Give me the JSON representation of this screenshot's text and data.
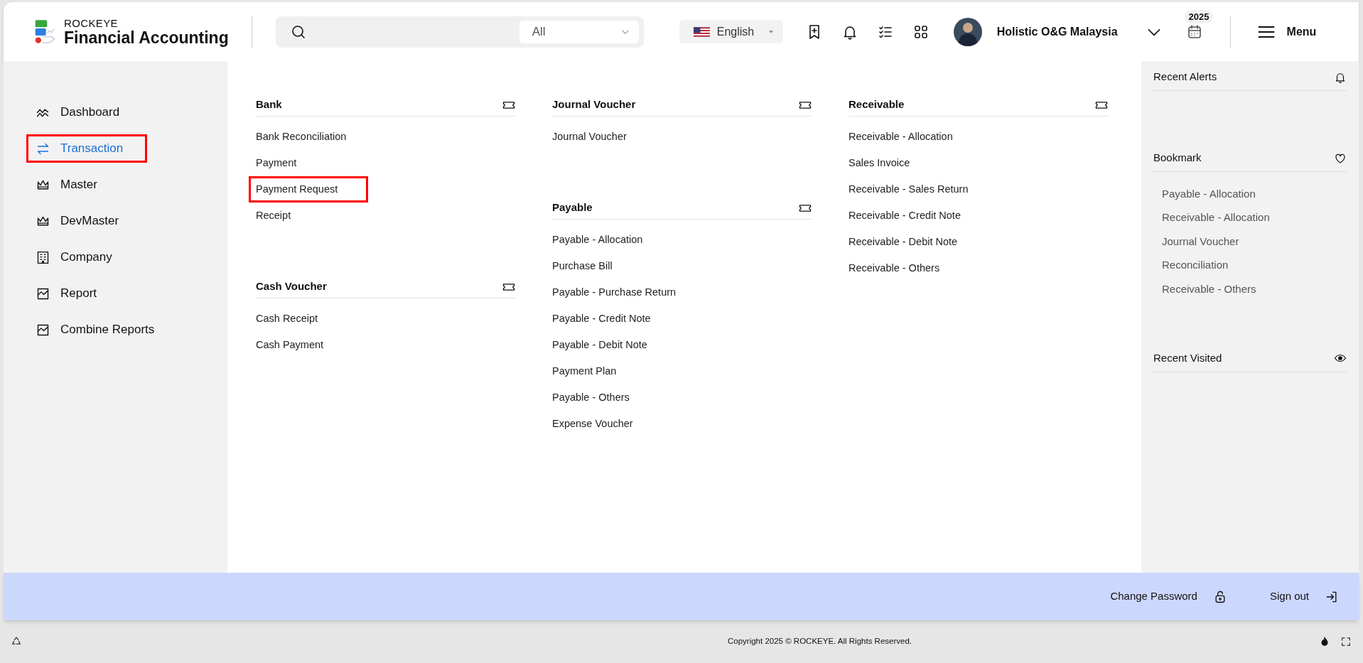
{
  "header": {
    "brand_top": "ROCKEYE",
    "brand_name": "Financial Accounting",
    "search": {
      "filter": "All"
    },
    "language": "English",
    "user": "Holistic O&G Malaysia",
    "year_badge": "2025",
    "menu_label": "Menu"
  },
  "sidebar": {
    "items": [
      {
        "label": "Dashboard",
        "selected": false,
        "highlighted": false
      },
      {
        "label": "Transaction",
        "selected": true,
        "highlighted": true
      },
      {
        "label": "Master",
        "selected": false,
        "highlighted": false
      },
      {
        "label": "DevMaster",
        "selected": false,
        "highlighted": false
      },
      {
        "label": "Company",
        "selected": false,
        "highlighted": false
      },
      {
        "label": "Report",
        "selected": false,
        "highlighted": false
      },
      {
        "label": "Combine Reports",
        "selected": false,
        "highlighted": false
      }
    ]
  },
  "columns": [
    [
      {
        "title": "Bank",
        "items": [
          {
            "label": "Bank Reconciliation",
            "highlighted": false
          },
          {
            "label": "Payment",
            "highlighted": false
          },
          {
            "label": "Payment Request",
            "highlighted": true
          },
          {
            "label": "Receipt",
            "highlighted": false
          }
        ]
      },
      {
        "title": "Cash Voucher",
        "items": [
          {
            "label": "Cash Receipt",
            "highlighted": false
          },
          {
            "label": "Cash Payment",
            "highlighted": false
          }
        ]
      }
    ],
    [
      {
        "title": "Journal Voucher",
        "items": [
          {
            "label": "Journal Voucher",
            "highlighted": false
          }
        ]
      },
      {
        "title": "Payable",
        "items": [
          {
            "label": "Payable - Allocation",
            "highlighted": false
          },
          {
            "label": "Purchase Bill",
            "highlighted": false
          },
          {
            "label": "Payable - Purchase Return",
            "highlighted": false
          },
          {
            "label": "Payable - Credit Note",
            "highlighted": false
          },
          {
            "label": "Payable - Debit Note",
            "highlighted": false
          },
          {
            "label": "Payment Plan",
            "highlighted": false
          },
          {
            "label": "Payable - Others",
            "highlighted": false
          },
          {
            "label": "Expense Voucher",
            "highlighted": false
          }
        ]
      }
    ],
    [
      {
        "title": "Receivable",
        "items": [
          {
            "label": "Receivable - Allocation",
            "highlighted": false
          },
          {
            "label": "Sales Invoice",
            "highlighted": false
          },
          {
            "label": "Receivable - Sales Return",
            "highlighted": false
          },
          {
            "label": "Receivable - Credit Note",
            "highlighted": false
          },
          {
            "label": "Receivable - Debit Note",
            "highlighted": false
          },
          {
            "label": "Receivable - Others",
            "highlighted": false
          }
        ]
      }
    ]
  ],
  "right_panel": [
    {
      "title": "Recent Alerts"
    },
    {
      "title": "Bookmark",
      "items": [
        "Payable - Allocation",
        "Receivable - Allocation",
        "Journal Voucher",
        "Reconciliation",
        "Receivable - Others"
      ]
    },
    {
      "title": "Recent Visited"
    }
  ],
  "action_bar": {
    "change_password": "Change Password",
    "sign_out": "Sign out"
  },
  "footer": {
    "copyright": "Copyright 2025 © ROCKEYE. All Rights Reserved."
  }
}
